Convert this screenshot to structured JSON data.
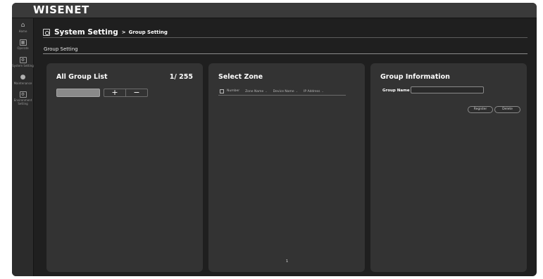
{
  "app": {
    "logo": "WISENET"
  },
  "sidebar": {
    "items": [
      {
        "label": "Home",
        "icon": "home-icon"
      },
      {
        "label": "Operate",
        "icon": "operate-icon"
      },
      {
        "label": "System Setting",
        "icon": "system-setting-icon"
      },
      {
        "label": "Maintenance",
        "icon": "maintenance-icon"
      },
      {
        "label": "Environment Setting",
        "icon": "environment-icon"
      }
    ]
  },
  "header": {
    "title": "System Setting",
    "separator": ">",
    "subtitle": "Group Setting"
  },
  "tab": {
    "label": "Group Setting"
  },
  "group_list": {
    "title": "All Group List",
    "count": "1/ 255",
    "add_label": "+",
    "remove_label": "−"
  },
  "select_zone": {
    "title": "Select Zone",
    "columns": [
      {
        "label": "Number",
        "sortable": false
      },
      {
        "label": "Zone Name",
        "sortable": true
      },
      {
        "label": "Device Name",
        "sortable": true
      },
      {
        "label": "IP Address",
        "sortable": true
      }
    ],
    "sort_glyph": "⌄",
    "page": "1"
  },
  "group_info": {
    "title": "Group Information",
    "name_label": "Group Name",
    "name_value": "",
    "register_label": "Register",
    "delete_label": "Delete"
  },
  "colors": {
    "background": "#1f1f1f",
    "topbar": "#3a3a3a",
    "panel": "#333333",
    "text": "#ffffff"
  }
}
